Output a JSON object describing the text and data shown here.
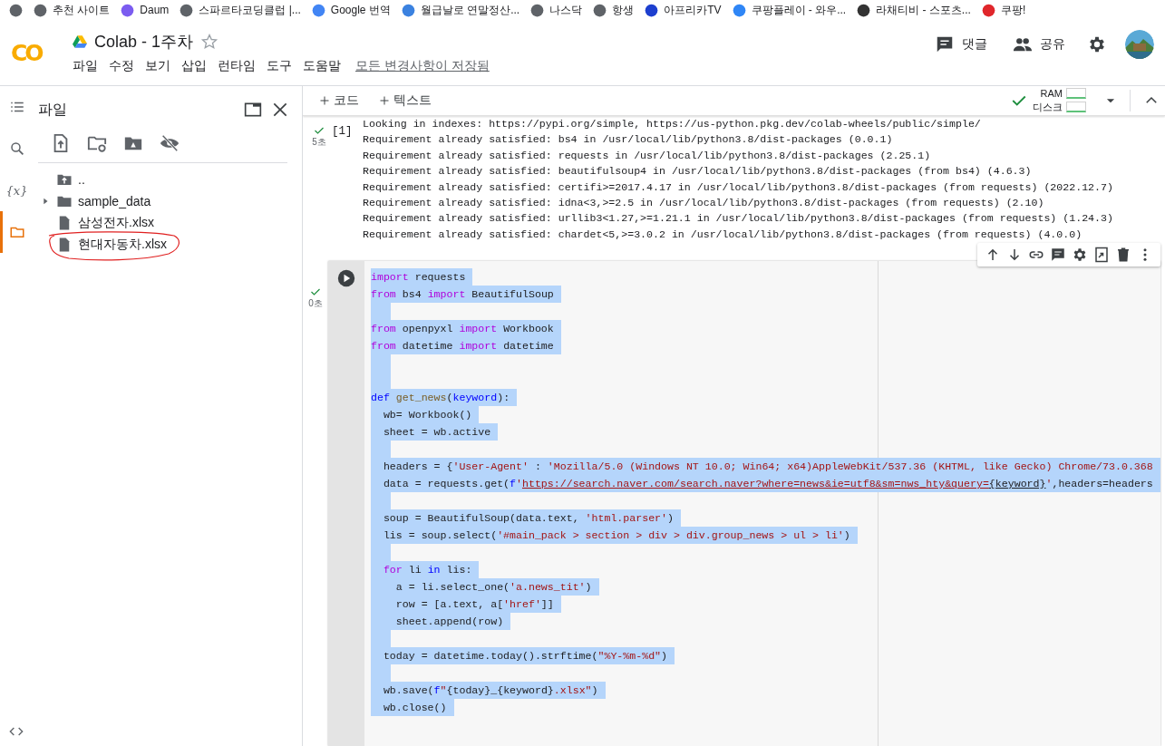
{
  "bookmarks": [
    {
      "color": "#5f6368"
    },
    {
      "label": "추천 사이트",
      "color": "#5f6368"
    },
    {
      "label": "Daum",
      "color": "#7b5cf0"
    },
    {
      "label": "스파르타코딩클럽 |...",
      "color": "#5f6368"
    },
    {
      "label": "Google 번역",
      "color": "#4285f4"
    },
    {
      "label": "월급날로 연말정산...",
      "color": "#3b82e0"
    },
    {
      "label": "나스닥",
      "color": "#5f6368"
    },
    {
      "label": "항생",
      "color": "#5f6368"
    },
    {
      "label": "아프리카TV",
      "color": "#1d3fcf"
    },
    {
      "label": "쿠팡플레이 - 와우...",
      "color": "#2f86f6"
    },
    {
      "label": "라채티비 - 스포츠...",
      "color": "#333333"
    },
    {
      "label": "쿠팡!",
      "color": "#e0262b"
    }
  ],
  "header": {
    "logo": "CO",
    "title": "Colab - 1주차",
    "starred": false,
    "menu": [
      "파일",
      "수정",
      "보기",
      "삽입",
      "런타임",
      "도구",
      "도움말"
    ],
    "save_status": "모든 변경사항이 저장됨",
    "actions": [
      {
        "kind": "comment",
        "label": "댓글"
      },
      {
        "kind": "share",
        "label": "공유"
      }
    ]
  },
  "rail": [
    {
      "kind": "toc",
      "selected": false
    },
    {
      "kind": "search",
      "selected": false
    },
    {
      "kind": "variables",
      "label": "{x}",
      "selected": false
    },
    {
      "kind": "files",
      "selected": true
    }
  ],
  "files_panel": {
    "title": "파일",
    "tree": [
      {
        "kind": "parent",
        "name": ".."
      },
      {
        "kind": "folder",
        "name": "sample_data",
        "expanded": false
      },
      {
        "kind": "file",
        "name": "삼성전자.xlsx",
        "highlighted": false
      },
      {
        "kind": "file",
        "name": "현대자동차.xlsx",
        "highlighted": true
      }
    ]
  },
  "toolbar": {
    "add_buttons": [
      "코드",
      "텍스트"
    ],
    "resources": [
      "RAM",
      "디스크"
    ]
  },
  "output_cell": {
    "time": "5초",
    "prompt": "[1]",
    "lines": [
      "Looking in indexes: https://pypi.org/simple, https://us-python.pkg.dev/colab-wheels/public/simple/",
      "Requirement already satisfied: bs4 in /usr/local/lib/python3.8/dist-packages (0.0.1)",
      "Requirement already satisfied: requests in /usr/local/lib/python3.8/dist-packages (2.25.1)",
      "Requirement already satisfied: beautifulsoup4 in /usr/local/lib/python3.8/dist-packages (from bs4) (4.6.3)",
      "Requirement already satisfied: certifi>=2017.4.17 in /usr/local/lib/python3.8/dist-packages (from requests) (2022.12.7)",
      "Requirement already satisfied: idna<3,>=2.5 in /usr/local/lib/python3.8/dist-packages (from requests) (2.10)",
      "Requirement already satisfied: urllib3<1.27,>=1.21.1 in /usr/local/lib/python3.8/dist-packages (from requests) (1.24.3)",
      "Requirement already satisfied: chardet<5,>=3.0.2 in /usr/local/lib/python3.8/dist-packages (from requests) (4.0.0)"
    ]
  },
  "code_cell": {
    "time": "0초",
    "lines": [
      {
        "selected": true,
        "tokens": [
          {
            "kind": "keyword",
            "text": "import"
          },
          {
            "kind": "plain",
            "text": " requests"
          }
        ]
      },
      {
        "selected": true,
        "tokens": [
          {
            "kind": "keyword",
            "text": "from"
          },
          {
            "kind": "plain",
            "text": " bs4 "
          },
          {
            "kind": "keyword",
            "text": "import"
          },
          {
            "kind": "plain",
            "text": " BeautifulSoup"
          }
        ]
      },
      {
        "selected": true
      },
      {
        "selected": true,
        "tokens": [
          {
            "kind": "keyword",
            "text": "from"
          },
          {
            "kind": "plain",
            "text": " openpyxl "
          },
          {
            "kind": "keyword",
            "text": "import"
          },
          {
            "kind": "plain",
            "text": " Workbook"
          }
        ]
      },
      {
        "selected": true,
        "tokens": [
          {
            "kind": "keyword",
            "text": "from"
          },
          {
            "kind": "plain",
            "text": " datetime "
          },
          {
            "kind": "keyword",
            "text": "import"
          },
          {
            "kind": "plain",
            "text": " datetime"
          }
        ]
      },
      {
        "selected": true
      },
      {
        "selected": true
      },
      {
        "selected": true,
        "tokens": [
          {
            "kind": "builtin",
            "text": "def"
          },
          {
            "kind": "function",
            "text": " get_news"
          },
          {
            "kind": "plain",
            "text": "("
          },
          {
            "kind": "builtin",
            "text": "keyword"
          },
          {
            "kind": "plain",
            "text": "):"
          }
        ]
      },
      {
        "selected": true,
        "tokens": [
          {
            "kind": "plain",
            "text": "  wb= Workbook()"
          }
        ]
      },
      {
        "selected": true,
        "tokens": [
          {
            "kind": "plain",
            "text": "  sheet = wb.active"
          }
        ]
      },
      {
        "selected": true
      },
      {
        "selected": true,
        "tokens": [
          {
            "kind": "plain",
            "text": "  headers = {"
          },
          {
            "kind": "string",
            "text": "'User-Agent'"
          },
          {
            "kind": "plain",
            "text": " : "
          },
          {
            "kind": "string",
            "text": "'Mozilla/5.0 (Windows NT 10.0; Win64; x64)AppleWebKit/537.36 (KHTML, like Gecko) Chrome/73.0.368"
          }
        ]
      },
      {
        "selected": true,
        "tokens": [
          {
            "kind": "plain",
            "text": "  data = requests.get("
          },
          {
            "kind": "builtin",
            "text": "f"
          },
          {
            "kind": "string",
            "text": "'"
          },
          {
            "kind": "link",
            "text": "https://search.naver.com/search.naver?where=news&ie=utf8&sm=nws_hty&query="
          },
          {
            "kind": "link-plain",
            "text": "{keyword}"
          },
          {
            "kind": "string",
            "text": "'"
          },
          {
            "kind": "plain",
            "text": ",headers=headers"
          }
        ]
      },
      {
        "selected": true
      },
      {
        "selected": true,
        "tokens": [
          {
            "kind": "plain",
            "text": "  soup = BeautifulSoup(data.text, "
          },
          {
            "kind": "string",
            "text": "'html.parser'"
          },
          {
            "kind": "plain",
            "text": ")"
          }
        ]
      },
      {
        "selected": true,
        "tokens": [
          {
            "kind": "plain",
            "text": "  lis = soup.select("
          },
          {
            "kind": "string",
            "text": "'#main_pack > section > div > div.group_news > ul > li'"
          },
          {
            "kind": "plain",
            "text": ")"
          }
        ]
      },
      {
        "selected": true
      },
      {
        "selected": true,
        "tokens": [
          {
            "kind": "keyword",
            "text": "  for"
          },
          {
            "kind": "plain",
            "text": " li "
          },
          {
            "kind": "builtin",
            "text": "in"
          },
          {
            "kind": "plain",
            "text": " lis:"
          }
        ]
      },
      {
        "selected": true,
        "tokens": [
          {
            "kind": "plain",
            "text": "    a = li.select_one("
          },
          {
            "kind": "string",
            "text": "'a.news_tit'"
          },
          {
            "kind": "plain",
            "text": ")"
          }
        ]
      },
      {
        "selected": true,
        "tokens": [
          {
            "kind": "plain",
            "text": "    row = [a.text, a["
          },
          {
            "kind": "string",
            "text": "'href'"
          },
          {
            "kind": "plain",
            "text": "]]"
          }
        ]
      },
      {
        "selected": true,
        "tokens": [
          {
            "kind": "plain",
            "text": "    sheet.append(row)"
          }
        ]
      },
      {
        "selected": true
      },
      {
        "selected": true,
        "tokens": [
          {
            "kind": "plain",
            "text": "  today = datetime.today().strftime("
          },
          {
            "kind": "string",
            "text": "\"%Y-%m-%d\""
          },
          {
            "kind": "plain",
            "text": ")"
          }
        ]
      },
      {
        "selected": true
      },
      {
        "selected": true,
        "tokens": [
          {
            "kind": "plain",
            "text": "  wb.save("
          },
          {
            "kind": "builtin",
            "text": "f"
          },
          {
            "kind": "string",
            "text": "\""
          },
          {
            "kind": "plain",
            "text": "{today}_{keyword}"
          },
          {
            "kind": "string",
            "text": ".xlsx\""
          },
          {
            "kind": "plain",
            "text": ")"
          }
        ]
      },
      {
        "selected": true,
        "tokens": [
          {
            "kind": "plain",
            "text": "  wb.close()"
          }
        ]
      }
    ]
  }
}
